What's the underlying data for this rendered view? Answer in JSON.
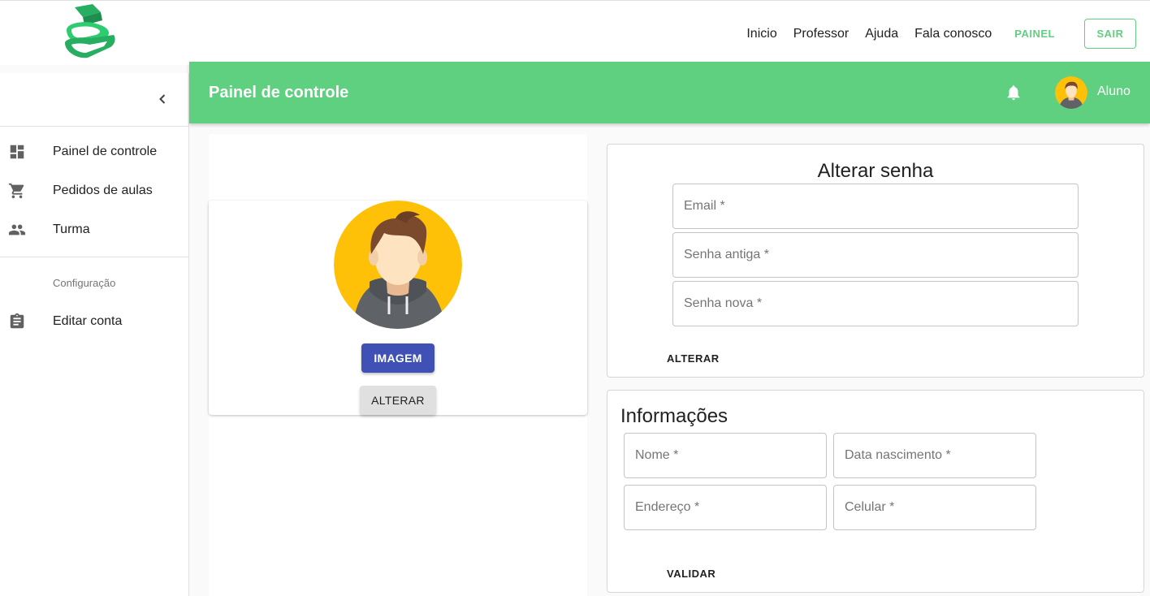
{
  "topnav": {
    "links": [
      "Inicio",
      "Professor",
      "Ajuda",
      "Fala conosco"
    ],
    "painel_label": "PAINEL",
    "sair_label": "SAIR"
  },
  "sidebar": {
    "items": [
      {
        "label": "Painel de controle",
        "icon": "dashboard-icon"
      },
      {
        "label": "Pedidos de aulas",
        "icon": "cart-icon"
      },
      {
        "label": "Turma",
        "icon": "people-icon"
      }
    ],
    "section_header": "Configuração",
    "config_items": [
      {
        "label": "Editar conta",
        "icon": "clipboard-icon"
      }
    ]
  },
  "appbar": {
    "title": "Painel de controle",
    "user": "Aluno"
  },
  "avatar_card": {
    "image_button": "IMAGEM",
    "change_button": "ALTERAR"
  },
  "password_form": {
    "title": "Alterar senha",
    "fields": {
      "email": "Email *",
      "old_password": "Senha antiga *",
      "new_password": "Senha nova *"
    },
    "submit": "ALTERAR"
  },
  "info_form": {
    "title": "Informações",
    "fields": {
      "name": "Nome *",
      "birthdate": "Data nascimento *",
      "address": "Endereço *",
      "phone": "Celular *"
    },
    "submit": "VALIDAR"
  },
  "colors": {
    "brand_green": "#5fcf80",
    "primary_blue": "#3f51b5",
    "avatar_yellow": "#ffc107"
  }
}
